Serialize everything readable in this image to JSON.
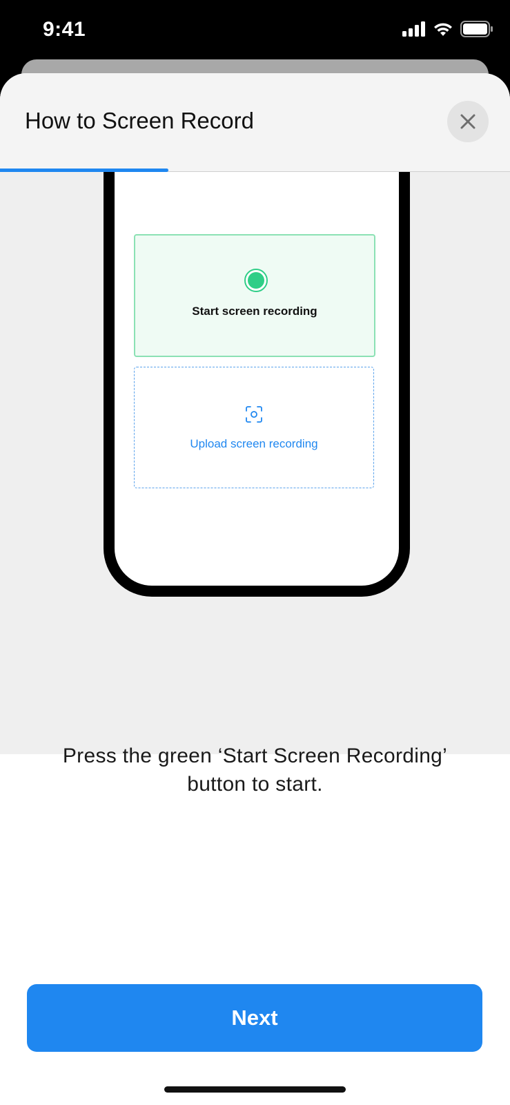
{
  "status_bar": {
    "time": "9:41",
    "icons": [
      "signal-icon",
      "wifi-icon",
      "battery-icon"
    ]
  },
  "sheet": {
    "title": "How to Screen Record",
    "close_icon": "close-icon",
    "progress": 0.33
  },
  "illustration": {
    "start_card": {
      "label": "Start screen recording",
      "icon": "record-dot-icon",
      "accent_color": "#2fce87"
    },
    "upload_card": {
      "label": "Upload screen recording",
      "icon": "capture-frame-icon",
      "accent_color": "#1f87f0"
    }
  },
  "instruction": "Press the green ‘Start Screen Recording’ button to start.",
  "next_button": {
    "label": "Next",
    "color": "#1f87f0"
  }
}
